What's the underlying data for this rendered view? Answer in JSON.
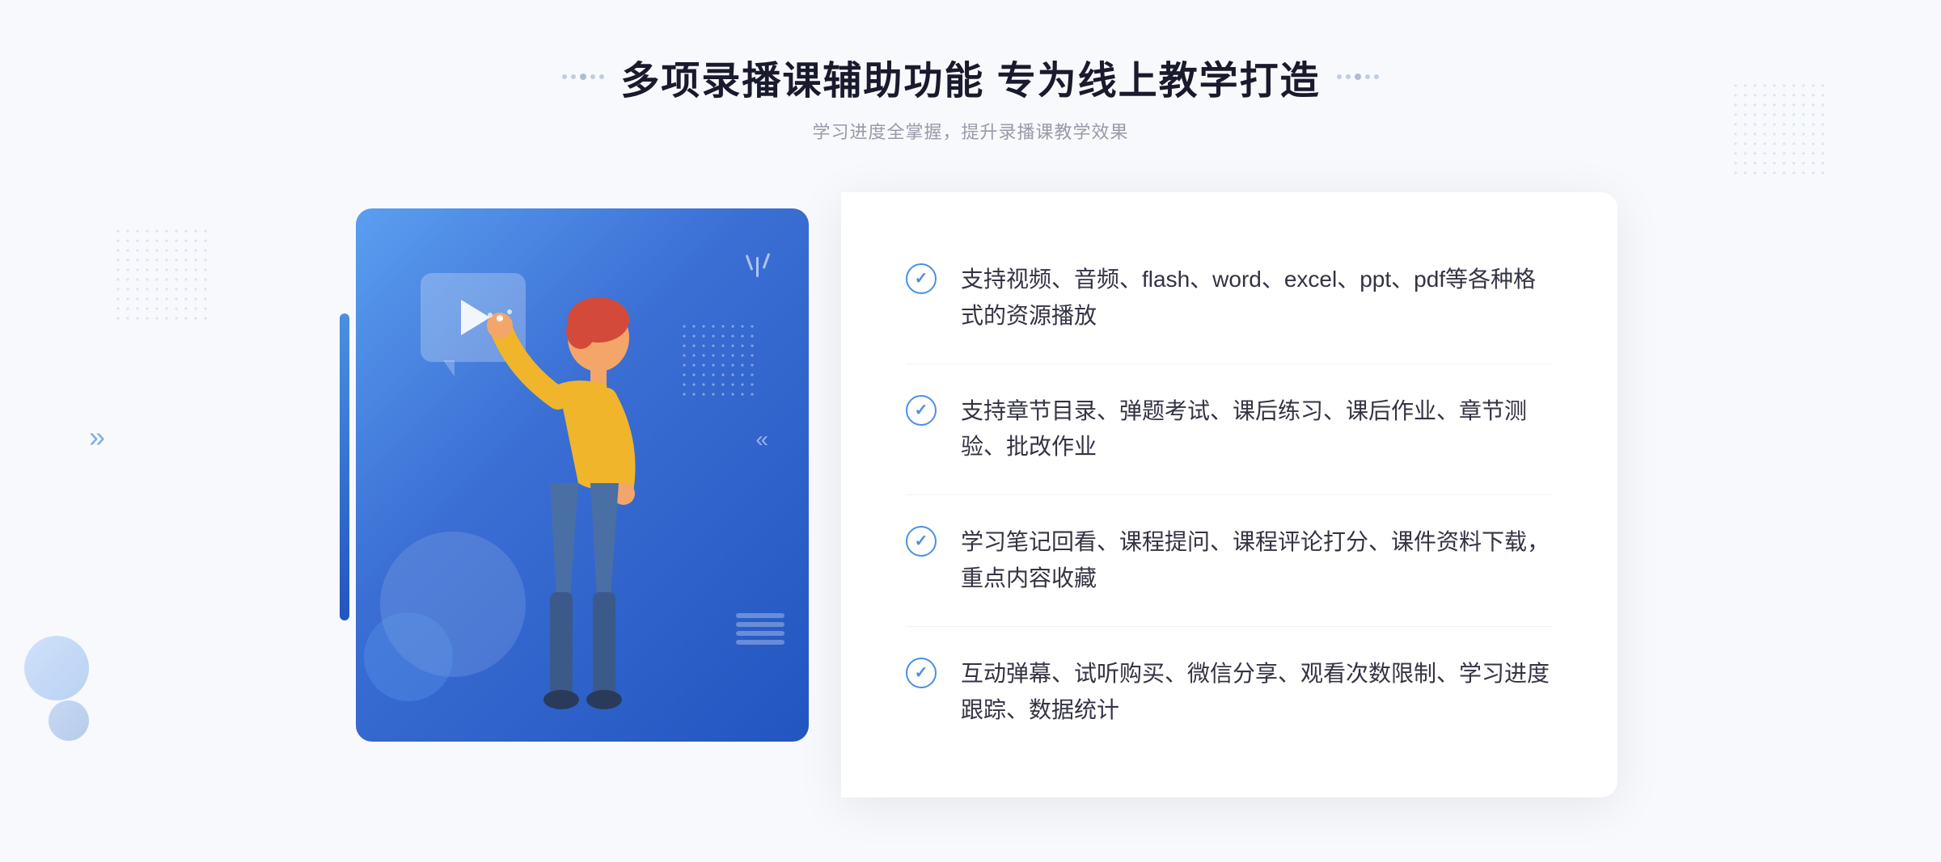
{
  "header": {
    "title": "多项录播课辅助功能 专为线上教学打造",
    "subtitle": "学习进度全掌握，提升录播课教学效果",
    "dots_decoration": ":::::"
  },
  "features": [
    {
      "id": "feature-1",
      "text": "支持视频、音频、flash、word、excel、ppt、pdf等各种格式的资源播放"
    },
    {
      "id": "feature-2",
      "text": "支持章节目录、弹题考试、课后练习、课后作业、章节测验、批改作业"
    },
    {
      "id": "feature-3",
      "text": "学习笔记回看、课程提问、课程评论打分、课件资料下载，重点内容收藏"
    },
    {
      "id": "feature-4",
      "text": "互动弹幕、试听购买、微信分享、观看次数限制、学习进度跟踪、数据统计"
    }
  ],
  "colors": {
    "primary": "#4a90e2",
    "title_color": "#1a1a2e",
    "subtitle_color": "#999aaa",
    "text_color": "#333344",
    "border_color": "#f0f2f5"
  },
  "icons": {
    "check": "✓",
    "play": "▶",
    "chevron": "»"
  }
}
